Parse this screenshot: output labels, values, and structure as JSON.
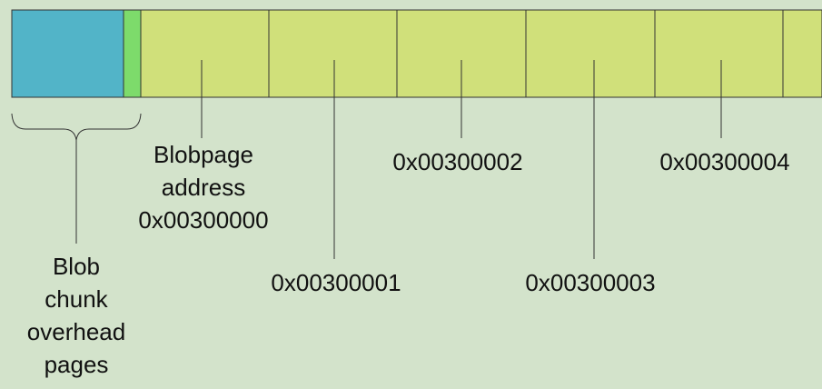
{
  "colors": {
    "background": "#d3e3cb",
    "overhead_block": "#52b4c8",
    "chunk_marker": "#7ddb6b",
    "blobpage_block": "#d0e07a",
    "outline": "#333333"
  },
  "labels": {
    "overhead_line1": "Blob",
    "overhead_line2": "chunk",
    "overhead_line3": "overhead",
    "overhead_line4": "pages",
    "page0_line1": "Blobpage",
    "page0_line2": "address",
    "page0_line3": "0x00300000",
    "page1": "0x00300001",
    "page2": "0x00300002",
    "page3": "0x00300003",
    "page4": "0x00300004"
  }
}
